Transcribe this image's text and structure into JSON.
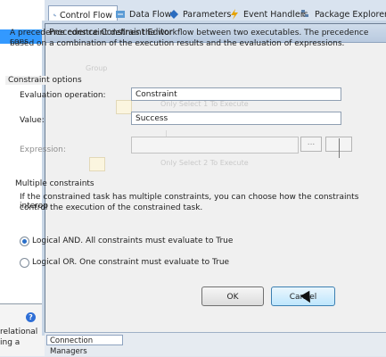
{
  "tabs": [
    {
      "label": "Control Flow",
      "icon": "control-flow-icon"
    },
    {
      "label": "Data Flow",
      "icon": "data-flow-icon"
    },
    {
      "label": "Parameters",
      "icon": "parameters-icon"
    },
    {
      "label": "Event Handlers",
      "icon": "event-handlers-icon"
    },
    {
      "label": "Package Explorer",
      "icon": "package-explorer-icon"
    }
  ],
  "dialog": {
    "title": "Precedence Constraint Editor",
    "intro_line1": "A precedence constraint defines the workflow between two executables. The precedence cons",
    "intro_line2": "based on a combination of the execution results and the evaluation of expressions.",
    "constraint_options": "Constraint options",
    "evaluation_label": "Evaluation operation:",
    "evaluation_value": "Constraint",
    "value_label": "Value:",
    "value_value": "Success",
    "expression_label": "Expression:",
    "expression_value": "",
    "ellipsis": "...",
    "multiple_constraints": "Multiple constraints",
    "multi_desc_line1": "If the constrained task has multiple constraints, you can choose how the constraints interop",
    "multi_desc_line2": "control the execution of the constrained task.",
    "and_label": "Logical AND. All constraints must evaluate to True",
    "or_label": "Logical OR. One constraint must evaluate to True",
    "ok": "OK",
    "cancel": "Cancel"
  },
  "ghost": {
    "group": "Group",
    "task1": "Only Select 1 To Execute",
    "task2": "Only Select 2 To Execute"
  },
  "left": {
    "line1": "relational",
    "line2": "ing a"
  },
  "bottom": {
    "connection_managers": "Connection Managers"
  }
}
